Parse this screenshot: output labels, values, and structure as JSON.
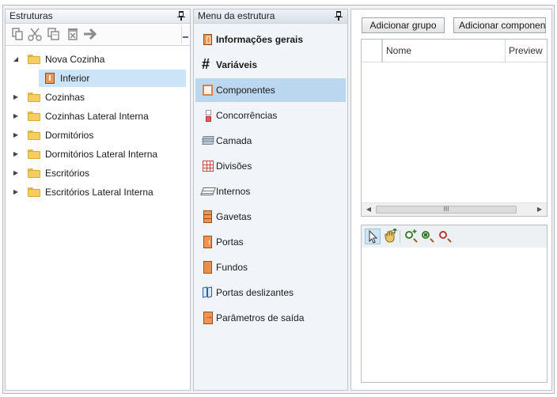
{
  "left_panel": {
    "title": "Estruturas",
    "toolbar": [
      "copy-icon",
      "cut-icon",
      "paste-icon",
      "delete-icon",
      "move-arrow-icon"
    ],
    "tree": [
      {
        "label": "Nova Cozinha",
        "expanded": true
      },
      {
        "label": "Inferior",
        "selected": true
      },
      {
        "label": "Cozinhas"
      },
      {
        "label": "Cozinhas Lateral Interna"
      },
      {
        "label": "Dormitórios"
      },
      {
        "label": "Dormitórios Lateral Interna"
      },
      {
        "label": "Escritórios"
      },
      {
        "label": "Escritórios Lateral Interna"
      }
    ]
  },
  "middle_panel": {
    "title": "Menu da estrutura",
    "items": [
      {
        "label": "Informações gerais",
        "icon": "cabinet-icon"
      },
      {
        "label": "Variáveis",
        "icon": "hash-icon"
      },
      {
        "label": "Componentes",
        "icon": "component-icon",
        "selected": true
      },
      {
        "label": "Concorrências",
        "icon": "concurrency-icon"
      },
      {
        "label": "Camada",
        "icon": "layer-icon"
      },
      {
        "label": "Divisões",
        "icon": "divisions-icon"
      },
      {
        "label": "Internos",
        "icon": "internal-icon"
      },
      {
        "label": "Gavetas",
        "icon": "drawer-icon"
      },
      {
        "label": "Portas",
        "icon": "door-icon"
      },
      {
        "label": "Fundos",
        "icon": "back-panel-icon"
      },
      {
        "label": "Portas deslizantes",
        "icon": "sliding-door-icon"
      },
      {
        "label": "Parâmetros de saída",
        "icon": "output-params-icon"
      }
    ]
  },
  "right_panel": {
    "add_group_label": "Adicionar grupo",
    "add_component_label": "Adicionar componente",
    "grid_columns": [
      "Nome",
      "Preview"
    ],
    "scroll_thumb": "III",
    "preview_tools": [
      "select-cursor-icon",
      "pan-hand-icon",
      "zoom-in-icon",
      "zoom-fit-icon",
      "zoom-reset-icon"
    ]
  },
  "colors": {
    "tree_selected": "#cce4f7",
    "menu_selected": "#bbd7ef",
    "accent_orange": "#e8965a"
  }
}
